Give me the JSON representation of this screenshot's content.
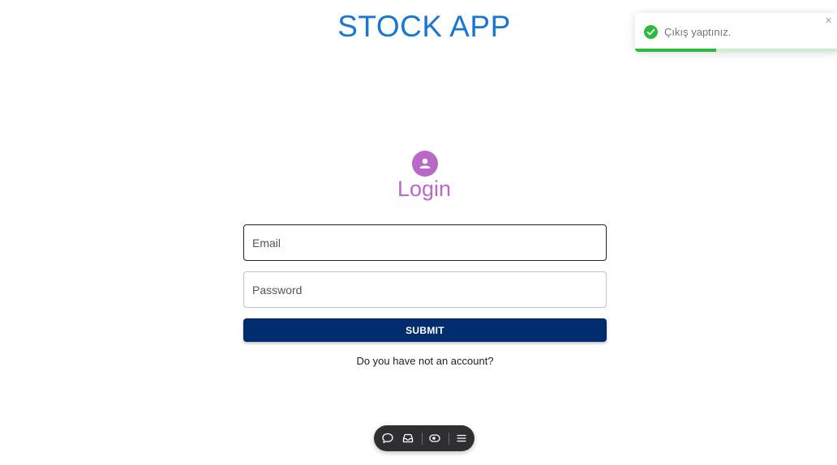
{
  "header": {
    "title": "STOCK APP"
  },
  "toast": {
    "message": "Çıkış yaptınız.",
    "close_label": "×",
    "progress_fraction": 0.4,
    "icon": "check-circle-icon",
    "accent_color": "#2eb93f"
  },
  "login": {
    "avatar_icon": "person-icon",
    "title": "Login",
    "email_placeholder": "Email",
    "password_placeholder": "Password",
    "submit_label": "SUBMIT",
    "register_prompt": "Do you have not an account?"
  },
  "toolbar": {
    "items": [
      "comment-icon",
      "inbox-icon",
      "eye-icon",
      "menu-icon"
    ]
  },
  "colors": {
    "title": "#1976d2",
    "accent_purple": "#ba68c8",
    "submit_bg": "#012c6d"
  }
}
